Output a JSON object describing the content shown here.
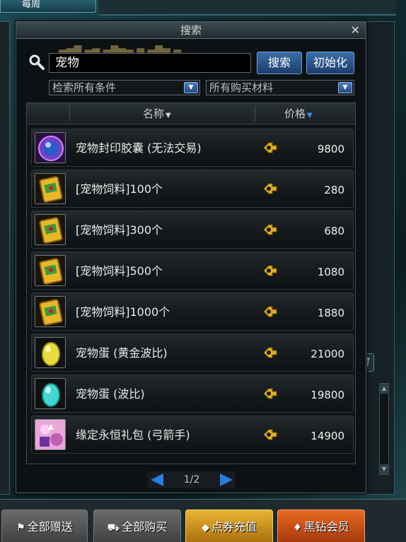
{
  "background": {
    "tab_label": "每周"
  },
  "window": {
    "title": "搜索",
    "close_glyph": "✕",
    "search": {
      "value": "宠物",
      "button_label": "搜索",
      "reset_label": "初始化"
    },
    "filters": {
      "condition": "检索所有条件",
      "materials": "所有购买材料"
    },
    "columns": {
      "name": "名称",
      "price": "价格"
    },
    "items": [
      {
        "name": "宠物封印胶囊 (无法交易)",
        "price": "9800",
        "icon": "purple-orb-icon"
      },
      {
        "name": "[宠物饲料]100个",
        "price": "280",
        "icon": "pet-food-icon"
      },
      {
        "name": "[宠物饲料]300个",
        "price": "680",
        "icon": "pet-food-icon"
      },
      {
        "name": "[宠物饲料]500个",
        "price": "1080",
        "icon": "pet-food-icon"
      },
      {
        "name": "[宠物饲料]1000个",
        "price": "1880",
        "icon": "pet-food-icon"
      },
      {
        "name": "宠物蛋 (黄金波比)",
        "price": "21000",
        "icon": "gold-egg-icon"
      },
      {
        "name": "宠物蛋 (波比)",
        "price": "19800",
        "icon": "cyan-egg-icon"
      },
      {
        "name": "缘定永恒礼包 (弓箭手)",
        "price": "14900",
        "icon": "gift-pack-icon"
      }
    ],
    "pagination": "1/2"
  },
  "bottom_bar": {
    "gift_all": "全部赠送",
    "buy_all": "全部购买",
    "recharge": "点券充值",
    "vip": "黑钻会员"
  },
  "colors": {
    "accent_blue": "#2a7de0",
    "gold": "#e8b432",
    "orange": "#e86a22"
  }
}
